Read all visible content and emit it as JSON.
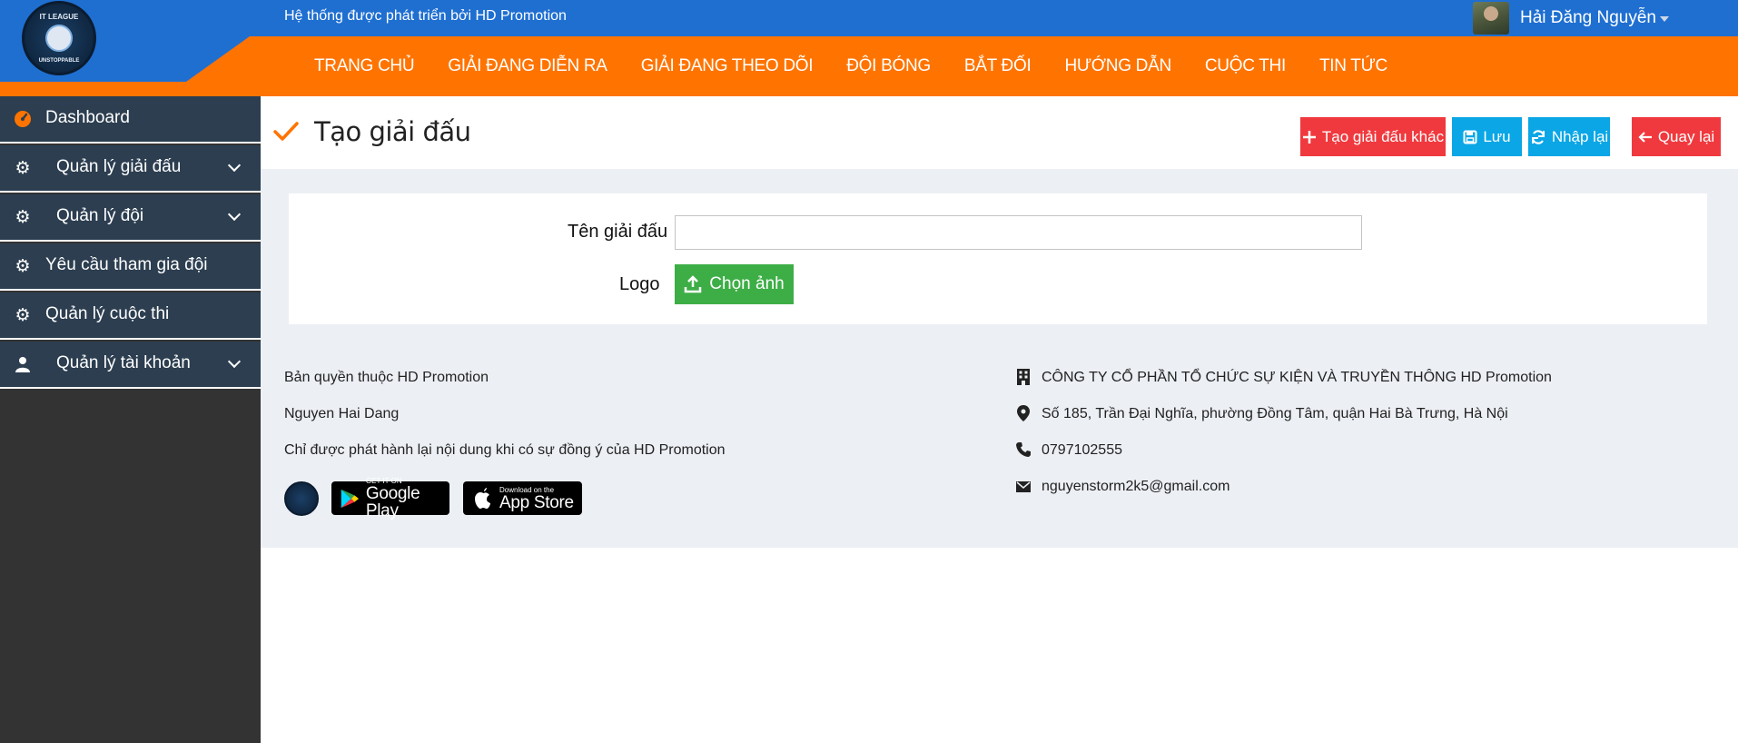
{
  "header": {
    "tagline": "Hệ thống được phát triển bởi HD Promotion",
    "user_name": "Hải Đăng Nguyễn",
    "logo_top_text": "IT LEAGUE",
    "logo_bottom_text": "UNSTOPPABLE"
  },
  "nav": {
    "items": [
      {
        "label": "TRANG CHỦ"
      },
      {
        "label": "GIẢI ĐANG DIỄN RA"
      },
      {
        "label": "GIẢI ĐANG THEO DÕI"
      },
      {
        "label": "ĐỘI BÓNG"
      },
      {
        "label": "BẮT ĐỐI"
      },
      {
        "label": "HƯỚNG DẪN"
      },
      {
        "label": "CUỘC THI"
      },
      {
        "label": "TIN TỨC"
      }
    ]
  },
  "sidebar": {
    "items": [
      {
        "label": "Dashboard",
        "icon": "dashboard-icon"
      },
      {
        "label": "Quản lý giải đấu",
        "icon": "gear-icon"
      },
      {
        "label": "Quản lý đội",
        "icon": "gear-icon"
      },
      {
        "label": "Yêu cầu tham gia đội",
        "icon": "gear-icon"
      },
      {
        "label": "Quản lý cuộc thi",
        "icon": "gear-icon"
      },
      {
        "label": "Quản lý tài khoản",
        "icon": "user-icon"
      }
    ]
  },
  "page": {
    "title": "Tạo giải đấu",
    "buttons": {
      "create_other": "Tạo giải đấu khác",
      "save": "Lưu",
      "reset": "Nhập lại",
      "back": "Quay lại"
    }
  },
  "form": {
    "name_label": "Tên giải đấu",
    "name_value": "",
    "logo_label": "Logo",
    "choose_image": "Chọn ảnh"
  },
  "footer": {
    "copyright": "Bản quyền thuộc HD Promotion",
    "author": "Nguyen Hai Dang",
    "notice": "Chỉ được phát hành lại nội dung khi có sự đồng ý của HD Promotion",
    "company": "CÔNG TY CỔ PHẦN TỔ CHỨC SỰ KIỆN VÀ TRUYỀN THÔNG HD Promotion",
    "address": "Số 185, Trần Đại Nghĩa, phường Đồng Tâm, quận Hai Bà Trưng, Hà Nội",
    "phone": "0797102555",
    "email": "nguyenstorm2k5@gmail.com",
    "google_play_small": "GET IT ON",
    "google_play_big": "Google Play",
    "app_store_small": "Download on the",
    "app_store_big": "App Store"
  },
  "colors": {
    "header_blue": "#1f6fd1",
    "nav_orange": "#ff7400",
    "sidebar_dark": "#2c3e50",
    "danger": "#f0393e",
    "info": "#0aa6e6",
    "success": "#3dae46"
  }
}
